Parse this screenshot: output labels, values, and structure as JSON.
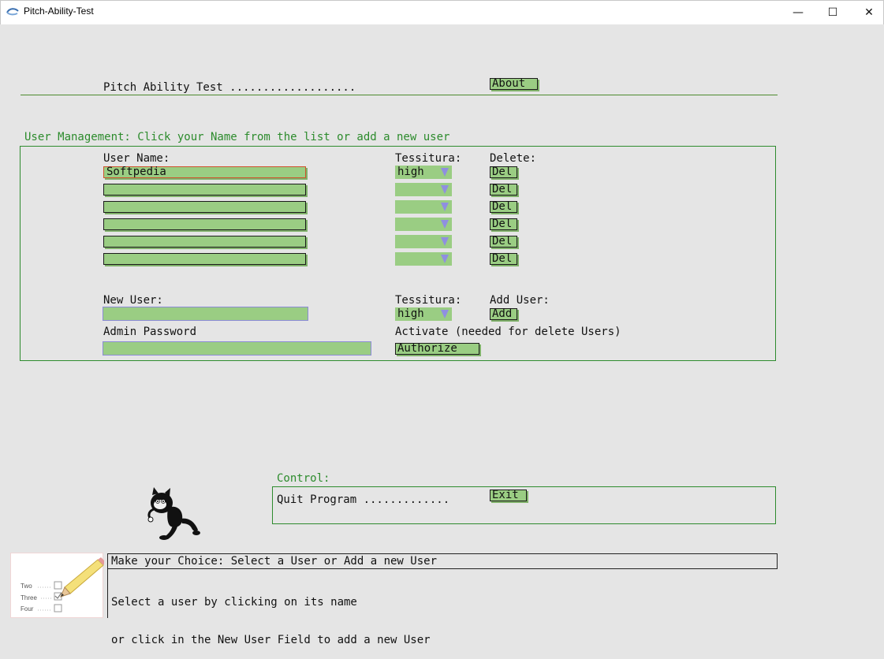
{
  "window": {
    "title": "Pitch-Ability-Test",
    "minimize_glyph": "—",
    "maximize_glyph": "☐",
    "close_glyph": "✕"
  },
  "header": {
    "title": "Pitch Ability Test ...................",
    "about_label": "About"
  },
  "user_management": {
    "caption": "User Management: Click your Name from the list or add a new user",
    "col_user_name": "User Name:",
    "col_tessitura": "Tessitura:",
    "col_delete": "Delete:",
    "rows": [
      {
        "name": "Softpedia",
        "tessitura": "high",
        "delete_label": "Del"
      },
      {
        "name": "",
        "tessitura": "",
        "delete_label": "Del"
      },
      {
        "name": "",
        "tessitura": "",
        "delete_label": "Del"
      },
      {
        "name": "",
        "tessitura": "",
        "delete_label": "Del"
      },
      {
        "name": "",
        "tessitura": "",
        "delete_label": "Del"
      },
      {
        "name": "",
        "tessitura": "",
        "delete_label": "Del"
      }
    ],
    "new_user_label": "New User:",
    "new_user_value": "",
    "new_tessitura_label": "Tessitura:",
    "new_tessitura_value": "high",
    "add_user_label": "Add User:",
    "add_button": "Add",
    "admin_password_label": "Admin Password",
    "admin_password_value": "",
    "activate_text": "Activate (needed for delete Users)",
    "authorize_button": "Authorize"
  },
  "control": {
    "caption": "Control:",
    "quit_text": "Quit Program .............",
    "exit_button": "Exit"
  },
  "status": {
    "heading": "Make your Choice: Select a User or Add a new User",
    "line1": "Select a user by clicking on its name",
    "line2": "or click in the New User Field to add a new User"
  },
  "checklist_illustration": {
    "items": [
      "Two",
      "Three",
      "Four"
    ]
  },
  "colors": {
    "field_green": "#9acd83",
    "frame_green": "#2e8b2e",
    "text_green": "#2c8b2c",
    "arrow_blue": "#8f8fe0",
    "background": "#e5e5e5"
  }
}
